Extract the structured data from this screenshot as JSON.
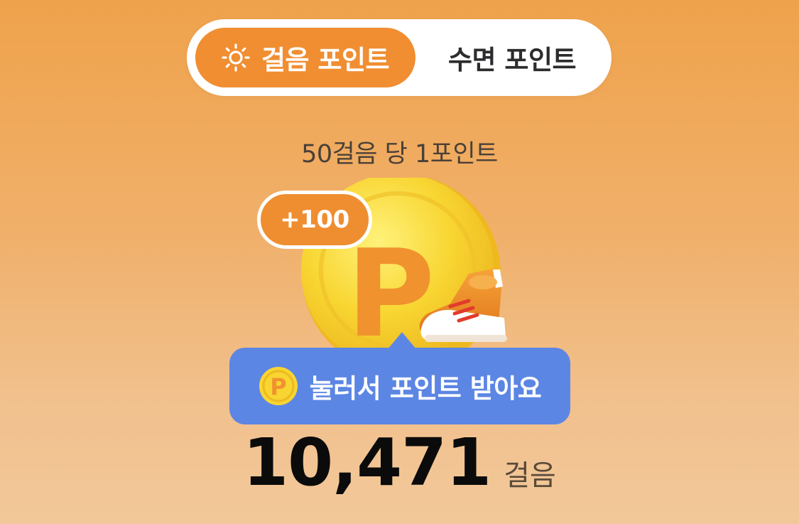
{
  "tabs": {
    "walk_label": "걸음 포인트",
    "sleep_label": "수면 포인트",
    "active_icon": "sun-icon"
  },
  "rate_text": "50걸음 당 1포인트",
  "bonus_badge": "+100",
  "claim_button": {
    "label": "눌러서 포인트 받아요",
    "icon": "point-coin-icon"
  },
  "steps": {
    "value": "10,471",
    "unit": "걸음"
  },
  "colors": {
    "accent": "#F08E31",
    "button_blue": "#5C86E3",
    "coin_yellow": "#F8D531"
  }
}
